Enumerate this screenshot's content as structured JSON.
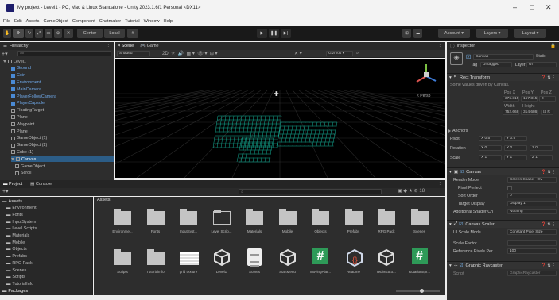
{
  "window": {
    "title": "My project - Level1 - PC, Mac & Linux Standalone - Unity 2023.1.6f1 Personal <DX11>",
    "controls": [
      "–",
      "□",
      "✕"
    ]
  },
  "menu": [
    "File",
    "Edit",
    "Assets",
    "GameObject",
    "Component",
    "Chatmaker",
    "Tutorial",
    "Window",
    "Help"
  ],
  "toolbar": {
    "pivot": "Center",
    "space": "Local",
    "account": "Account ▾",
    "layers": "Layers ▾",
    "layout": "Layout ▾"
  },
  "hierarchy": {
    "title": "Hierarchy",
    "search_placeholder": "All",
    "items": [
      {
        "label": "Level1",
        "indent": 0,
        "icon": "scene"
      },
      {
        "label": "Ground",
        "indent": 2,
        "icon": "cube-blue"
      },
      {
        "label": "Coin",
        "indent": 2,
        "icon": "cube-blue"
      },
      {
        "label": "Environment",
        "indent": 2,
        "icon": "cube-blue"
      },
      {
        "label": "MainCamera",
        "indent": 2,
        "icon": "cube-blue"
      },
      {
        "label": "PlayerFollowCamera",
        "indent": 2,
        "icon": "cube-blue"
      },
      {
        "label": "PlayerCapsule",
        "indent": 2,
        "icon": "cube-blue"
      },
      {
        "label": "FloatingTarget",
        "indent": 2,
        "icon": "cube"
      },
      {
        "label": "Plane",
        "indent": 2,
        "icon": "cube"
      },
      {
        "label": "Waypoint",
        "indent": 2,
        "icon": "cube"
      },
      {
        "label": "Plane",
        "indent": 2,
        "icon": "cube"
      },
      {
        "label": "GameObject (1)",
        "indent": 2,
        "icon": "cube"
      },
      {
        "label": "GameObject (2)",
        "indent": 2,
        "icon": "cube"
      },
      {
        "label": "Cube (1)",
        "indent": 2,
        "icon": "cube"
      },
      {
        "label": "Canvas",
        "indent": 2,
        "icon": "cube"
      },
      {
        "label": "GameObject",
        "indent": 3,
        "icon": "cube"
      },
      {
        "label": "Scroll",
        "indent": 3,
        "icon": "cube"
      }
    ]
  },
  "scene": {
    "tabs": [
      "Scene",
      "Game"
    ],
    "shading": "Shaded",
    "gizmos": "Gizmos ▾",
    "view_label": "< Persp"
  },
  "project": {
    "tabs": [
      "Project",
      "Console"
    ],
    "breadcrumb": "Assets",
    "tree": [
      {
        "label": "Assets",
        "indent": 0
      },
      {
        "label": "Environment",
        "indent": 1
      },
      {
        "label": "Fonts",
        "indent": 1
      },
      {
        "label": "InputSystem",
        "indent": 1
      },
      {
        "label": "Level Scripts",
        "indent": 1
      },
      {
        "label": "Materials",
        "indent": 1
      },
      {
        "label": "Mobile",
        "indent": 1
      },
      {
        "label": "Objects",
        "indent": 1
      },
      {
        "label": "Prefabs",
        "indent": 1
      },
      {
        "label": "RPG Pack",
        "indent": 1
      },
      {
        "label": "Scenes",
        "indent": 1
      },
      {
        "label": "Scripts",
        "indent": 1
      },
      {
        "label": "TutorialInfo",
        "indent": 1
      },
      {
        "label": "Packages",
        "indent": 0
      }
    ],
    "row1": [
      {
        "label": "Environme...",
        "kind": "folder"
      },
      {
        "label": "Fonts",
        "kind": "folder"
      },
      {
        "label": "InputSyst...",
        "kind": "folder"
      },
      {
        "label": "Level Scrip...",
        "kind": "folder-empty"
      },
      {
        "label": "Materials",
        "kind": "folder"
      },
      {
        "label": "Mobile",
        "kind": "folder"
      },
      {
        "label": "Objects",
        "kind": "folder"
      },
      {
        "label": "Prefabs",
        "kind": "folder"
      },
      {
        "label": "RPG Pack",
        "kind": "folder"
      },
      {
        "label": "Scenes",
        "kind": "folder"
      }
    ],
    "row2": [
      {
        "label": "Scripts",
        "kind": "folder"
      },
      {
        "label": "TutorialInfo",
        "kind": "folder"
      },
      {
        "label": "grid texture",
        "kind": "grid"
      },
      {
        "label": "Level1",
        "kind": "unity"
      },
      {
        "label": "Scores",
        "kind": "doc"
      },
      {
        "label": "StartMenu",
        "kind": "unity"
      },
      {
        "label": "MovingPlat...",
        "kind": "script"
      },
      {
        "label": "Readme",
        "kind": "readme"
      },
      {
        "label": "redirectLo...",
        "kind": "unity"
      },
      {
        "label": "RotationSpr...",
        "kind": "script"
      }
    ]
  },
  "inspector": {
    "title": "Inspector",
    "object_name": "Canvas",
    "static_label": "Static",
    "tag_label": "Tag",
    "tag_value": "Untagged",
    "layer_label": "Layer",
    "layer_value": "UI",
    "rect_transform": "Rect Transform",
    "rect_note": "Some values driven by Canvas.",
    "pos_headers": [
      "Pos X",
      "Pos Y",
      "Pos Z"
    ],
    "pos_values": [
      "376.315",
      "157.315",
      "0"
    ],
    "size_headers": [
      "Width",
      "Height"
    ],
    "size_values": [
      "752.668",
      "314.686"
    ],
    "anchors": "Anchors",
    "pivot_label": "Pivot",
    "pivot_values": [
      "X 0.5",
      "Y 0.5"
    ],
    "rotation_label": "Rotation",
    "rotation_values": [
      "X 0",
      "Y 0",
      "Z 0"
    ],
    "scale_label": "Scale",
    "scale_values": [
      "X 1",
      "Y 1",
      "Z 1"
    ],
    "canvas": "Canvas",
    "render_mode_label": "Render Mode",
    "render_mode_value": "Screen Space - Ov",
    "pixel_perfect": "Pixel Perfect",
    "sort_order_label": "Sort Order",
    "sort_order_value": "0",
    "target_display_label": "Target Display",
    "target_display_value": "Display 1",
    "shader_label": "Additional Shader Ch",
    "shader_value": "Nothing",
    "canvas_scaler": "Canvas Scaler",
    "ui_scale_label": "UI Scale Mode",
    "ui_scale_value": "Constant Pixel Size",
    "scale_factor_label": "Scale Factor",
    "ref_ppu_label": "Reference Pixels Per",
    "ref_ppu_value": "100",
    "graphic_raycaster": "Graphic Raycaster",
    "script_label": "Script",
    "script_value": "GraphicRaycaster"
  },
  "colors": {
    "accent": "#3d7bd6",
    "selection": "#2c5d87",
    "grid_green": "#15b39a"
  }
}
